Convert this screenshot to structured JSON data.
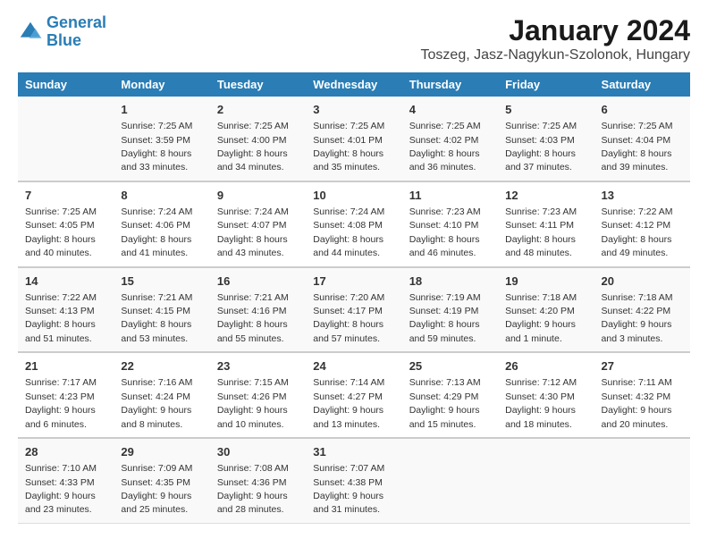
{
  "logo": {
    "line1": "General",
    "line2": "Blue"
  },
  "title": "January 2024",
  "subtitle": "Toszeg, Jasz-Nagykun-Szolonok, Hungary",
  "days_of_week": [
    "Sunday",
    "Monday",
    "Tuesday",
    "Wednesday",
    "Thursday",
    "Friday",
    "Saturday"
  ],
  "weeks": [
    [
      {
        "day": "",
        "sunrise": "",
        "sunset": "",
        "daylight": ""
      },
      {
        "day": "1",
        "sunrise": "Sunrise: 7:25 AM",
        "sunset": "Sunset: 3:59 PM",
        "daylight": "Daylight: 8 hours and 33 minutes."
      },
      {
        "day": "2",
        "sunrise": "Sunrise: 7:25 AM",
        "sunset": "Sunset: 4:00 PM",
        "daylight": "Daylight: 8 hours and 34 minutes."
      },
      {
        "day": "3",
        "sunrise": "Sunrise: 7:25 AM",
        "sunset": "Sunset: 4:01 PM",
        "daylight": "Daylight: 8 hours and 35 minutes."
      },
      {
        "day": "4",
        "sunrise": "Sunrise: 7:25 AM",
        "sunset": "Sunset: 4:02 PM",
        "daylight": "Daylight: 8 hours and 36 minutes."
      },
      {
        "day": "5",
        "sunrise": "Sunrise: 7:25 AM",
        "sunset": "Sunset: 4:03 PM",
        "daylight": "Daylight: 8 hours and 37 minutes."
      },
      {
        "day": "6",
        "sunrise": "Sunrise: 7:25 AM",
        "sunset": "Sunset: 4:04 PM",
        "daylight": "Daylight: 8 hours and 39 minutes."
      }
    ],
    [
      {
        "day": "7",
        "sunrise": "Sunrise: 7:25 AM",
        "sunset": "Sunset: 4:05 PM",
        "daylight": "Daylight: 8 hours and 40 minutes."
      },
      {
        "day": "8",
        "sunrise": "Sunrise: 7:24 AM",
        "sunset": "Sunset: 4:06 PM",
        "daylight": "Daylight: 8 hours and 41 minutes."
      },
      {
        "day": "9",
        "sunrise": "Sunrise: 7:24 AM",
        "sunset": "Sunset: 4:07 PM",
        "daylight": "Daylight: 8 hours and 43 minutes."
      },
      {
        "day": "10",
        "sunrise": "Sunrise: 7:24 AM",
        "sunset": "Sunset: 4:08 PM",
        "daylight": "Daylight: 8 hours and 44 minutes."
      },
      {
        "day": "11",
        "sunrise": "Sunrise: 7:23 AM",
        "sunset": "Sunset: 4:10 PM",
        "daylight": "Daylight: 8 hours and 46 minutes."
      },
      {
        "day": "12",
        "sunrise": "Sunrise: 7:23 AM",
        "sunset": "Sunset: 4:11 PM",
        "daylight": "Daylight: 8 hours and 48 minutes."
      },
      {
        "day": "13",
        "sunrise": "Sunrise: 7:22 AM",
        "sunset": "Sunset: 4:12 PM",
        "daylight": "Daylight: 8 hours and 49 minutes."
      }
    ],
    [
      {
        "day": "14",
        "sunrise": "Sunrise: 7:22 AM",
        "sunset": "Sunset: 4:13 PM",
        "daylight": "Daylight: 8 hours and 51 minutes."
      },
      {
        "day": "15",
        "sunrise": "Sunrise: 7:21 AM",
        "sunset": "Sunset: 4:15 PM",
        "daylight": "Daylight: 8 hours and 53 minutes."
      },
      {
        "day": "16",
        "sunrise": "Sunrise: 7:21 AM",
        "sunset": "Sunset: 4:16 PM",
        "daylight": "Daylight: 8 hours and 55 minutes."
      },
      {
        "day": "17",
        "sunrise": "Sunrise: 7:20 AM",
        "sunset": "Sunset: 4:17 PM",
        "daylight": "Daylight: 8 hours and 57 minutes."
      },
      {
        "day": "18",
        "sunrise": "Sunrise: 7:19 AM",
        "sunset": "Sunset: 4:19 PM",
        "daylight": "Daylight: 8 hours and 59 minutes."
      },
      {
        "day": "19",
        "sunrise": "Sunrise: 7:18 AM",
        "sunset": "Sunset: 4:20 PM",
        "daylight": "Daylight: 9 hours and 1 minute."
      },
      {
        "day": "20",
        "sunrise": "Sunrise: 7:18 AM",
        "sunset": "Sunset: 4:22 PM",
        "daylight": "Daylight: 9 hours and 3 minutes."
      }
    ],
    [
      {
        "day": "21",
        "sunrise": "Sunrise: 7:17 AM",
        "sunset": "Sunset: 4:23 PM",
        "daylight": "Daylight: 9 hours and 6 minutes."
      },
      {
        "day": "22",
        "sunrise": "Sunrise: 7:16 AM",
        "sunset": "Sunset: 4:24 PM",
        "daylight": "Daylight: 9 hours and 8 minutes."
      },
      {
        "day": "23",
        "sunrise": "Sunrise: 7:15 AM",
        "sunset": "Sunset: 4:26 PM",
        "daylight": "Daylight: 9 hours and 10 minutes."
      },
      {
        "day": "24",
        "sunrise": "Sunrise: 7:14 AM",
        "sunset": "Sunset: 4:27 PM",
        "daylight": "Daylight: 9 hours and 13 minutes."
      },
      {
        "day": "25",
        "sunrise": "Sunrise: 7:13 AM",
        "sunset": "Sunset: 4:29 PM",
        "daylight": "Daylight: 9 hours and 15 minutes."
      },
      {
        "day": "26",
        "sunrise": "Sunrise: 7:12 AM",
        "sunset": "Sunset: 4:30 PM",
        "daylight": "Daylight: 9 hours and 18 minutes."
      },
      {
        "day": "27",
        "sunrise": "Sunrise: 7:11 AM",
        "sunset": "Sunset: 4:32 PM",
        "daylight": "Daylight: 9 hours and 20 minutes."
      }
    ],
    [
      {
        "day": "28",
        "sunrise": "Sunrise: 7:10 AM",
        "sunset": "Sunset: 4:33 PM",
        "daylight": "Daylight: 9 hours and 23 minutes."
      },
      {
        "day": "29",
        "sunrise": "Sunrise: 7:09 AM",
        "sunset": "Sunset: 4:35 PM",
        "daylight": "Daylight: 9 hours and 25 minutes."
      },
      {
        "day": "30",
        "sunrise": "Sunrise: 7:08 AM",
        "sunset": "Sunset: 4:36 PM",
        "daylight": "Daylight: 9 hours and 28 minutes."
      },
      {
        "day": "31",
        "sunrise": "Sunrise: 7:07 AM",
        "sunset": "Sunset: 4:38 PM",
        "daylight": "Daylight: 9 hours and 31 minutes."
      },
      {
        "day": "",
        "sunrise": "",
        "sunset": "",
        "daylight": ""
      },
      {
        "day": "",
        "sunrise": "",
        "sunset": "",
        "daylight": ""
      },
      {
        "day": "",
        "sunrise": "",
        "sunset": "",
        "daylight": ""
      }
    ]
  ]
}
